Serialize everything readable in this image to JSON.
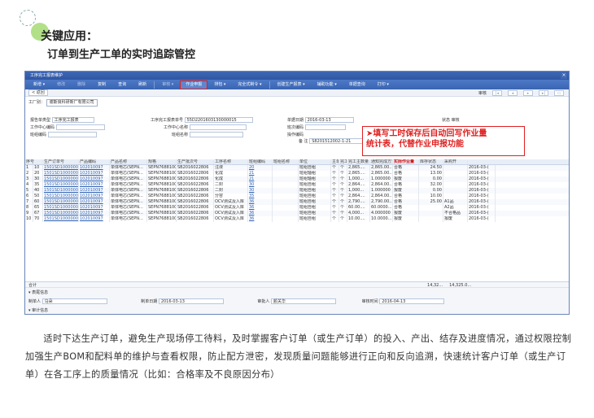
{
  "heading": {
    "title": "关键应用：",
    "subtitle": "订单到生产工单的实时追踪管控"
  },
  "window": {
    "title": "工序完工报表维护",
    "close": "×"
  },
  "toolbar": {
    "items": [
      "新增 ▾",
      "修改",
      "删除",
      "复制",
      "查询",
      "刷新",
      "审核 ▾",
      "作业申报",
      "排包 ▾",
      "完全式制令 ▾",
      "创建生产报表 ▾",
      "辅助功能 ▾",
      "单据查询",
      "打印 ▾"
    ],
    "dim": [
      1,
      2,
      6
    ]
  },
  "nav": {
    "back": "< 返回",
    "audit": "审核"
  },
  "workshop": {
    "label": "工厂别：",
    "value": "谢斯良科研新厂有限公司"
  },
  "form": {
    "report_type_label": "报告单类型",
    "report_type": "工序完工报表",
    "work_center_label": "工作中心编码",
    "team_label": "班组编码",
    "doc_no_label": "工序完工报表单号",
    "doc_no": "55D2201603130000015",
    "wc_name_label": "工作中心名称",
    "team_name_label": "班组名称",
    "date_label": "单据日期",
    "date": "2016-03-13",
    "shift_label": "班次编码",
    "person_label": "操作编码",
    "remark_label": "备 注",
    "remark": "S8201512002-1-21",
    "status_label": "状态",
    "status": "审核"
  },
  "callout": {
    "line1": "➤填写工时保存后自动回写作业量",
    "line2": "统计表，代替作业申报功能"
  },
  "grid": {
    "headers": [
      "序号",
      "生产订单号",
      "产品编码",
      "产品名称",
      "规格",
      "生产批次号",
      "工序名称",
      "班组编码",
      "班组名称",
      "单位",
      "主单位",
      "完工主数量",
      "完工主数量",
      "通知完成方式",
      "实际作业量",
      "库存状态",
      "采购开"
    ],
    "rows": [
      [
        "1",
        "10",
        "1501SD1000000/1",
        "102010097",
        "单体电芯(SEPN...",
        "SEPN7688100...",
        "SB2016022806",
        "注液",
        "20",
        "",
        "班组自租",
        "个",
        "个",
        "2,865....",
        "2,865.00...",
        "合格",
        "24.50",
        "",
        "2016-03-("
      ],
      [
        "2",
        "20",
        "1501SD1000000/1",
        "102010097",
        "单体电芯(SEPN...",
        "SEPN7688100...",
        "SB2016022806",
        "化成",
        "21",
        "",
        "班组轴租",
        "个",
        "个",
        "2,865....",
        "2,865.00...",
        "合格",
        "13.00",
        "",
        "2016-03-("
      ],
      [
        "3",
        "30",
        "1501SD1000000/1",
        "102010097",
        "单体电芯(SEPN...",
        "SEPN7688100...",
        "SB2016022806",
        "化成",
        "21",
        "",
        "班组轴租",
        "个",
        "个",
        "1,000...",
        "1.000000",
        "报废",
        "0.00",
        "",
        "2016-03-("
      ],
      [
        "4",
        "35",
        "1501SD1000000/1",
        "102010097",
        "单体电芯(SEPN...",
        "SEPN7688100...",
        "SB2016022806",
        "二封",
        "30",
        "",
        "班组自租",
        "个",
        "个",
        "2,864....",
        "2,864.00...",
        "合格",
        "32.00",
        "",
        "2016-03-("
      ],
      [
        "5",
        "40",
        "1501SD1000000/1",
        "102010097",
        "单体电芯(SEPN...",
        "SEPN7688100...",
        "SB2016022806",
        "二封",
        "30",
        "",
        "班组自租",
        "个",
        "个",
        "1,000...",
        "1.000000",
        "报废",
        "0.00",
        "",
        "2016-03-("
      ],
      [
        "6",
        "50",
        "1501SD1000000/1",
        "102010097",
        "单体电芯(SEPN...",
        "SEPN7688100...",
        "SB2016022806",
        "分容",
        "35",
        "",
        "班组自租",
        "个",
        "个",
        "2,864....",
        "2,864.00...",
        "合格",
        "10.00",
        "",
        "2016-03-("
      ],
      [
        "7",
        "60",
        "1501SD1000000/1",
        "102010097",
        "单体电芯(SEPN...",
        "SEPN7688100...",
        "SB2016022806",
        "OCV测试及入库",
        "36",
        "",
        "班组自租",
        "个",
        "个",
        "2,790....",
        "2,790.00...",
        "合格",
        "25.00",
        "A1品",
        "2016-03-("
      ],
      [
        "8",
        "65",
        "1501SD1000000/1",
        "102010097",
        "单体电芯(SEPN...",
        "SEPN7688100...",
        "SB2016022806",
        "OCV测试及入库",
        "36",
        "",
        "班组自租",
        "个",
        "个",
        "60.00....",
        "60.0000...",
        "合格",
        "",
        "A2品",
        "2016-03-("
      ],
      [
        "9",
        "67",
        "1501SD1000000/1",
        "102010097",
        "单体电芯(SEPN...",
        "SEPN7688100...",
        "SB2016022806",
        "OCV测试及入库",
        "36",
        "",
        "班组自租",
        "个",
        "个",
        "4,000...",
        "4.000000",
        "报废",
        "",
        "不合格品",
        "2016-03-("
      ],
      [
        "10",
        "70",
        "1501SD1000000/1",
        "102010097",
        "单体电芯(SEPN...",
        "SEPN7688100...",
        "SB2016022806",
        "OCV测试及入库",
        "36",
        "",
        "班组自租",
        "个",
        "个",
        "10.00....",
        "10.0000...",
        "报废",
        "",
        "报废",
        "2016-03-("
      ]
    ],
    "sum_label": "合计",
    "sum1": "14,32...",
    "sum2": "14,325.0..."
  },
  "footer": {
    "table_info": "表尾信息",
    "maker_label": "制单人",
    "maker": "马朵",
    "make_date_label": "制单日期",
    "make_date": "2016-03-13",
    "auditor_label": "审批人",
    "auditor": "颜关华",
    "audit_date_label": "审核时间",
    "audit_date": "2016-04-13",
    "audit_info": "审计信息"
  },
  "paragraph": "适时下达生产订单，避免生产现场停工待料，及时掌握客户订单（或生产订单）的投入、产出、结存及进度情况，通过权限控制加强生产BOM和配料单的维护与查看权限，防止配方泄密，发现质量问题能够进行正向和反向追溯，快速统计客户订单（或生产订单）在各工序上的质量情况（比如：合格率及不良原因分布）"
}
